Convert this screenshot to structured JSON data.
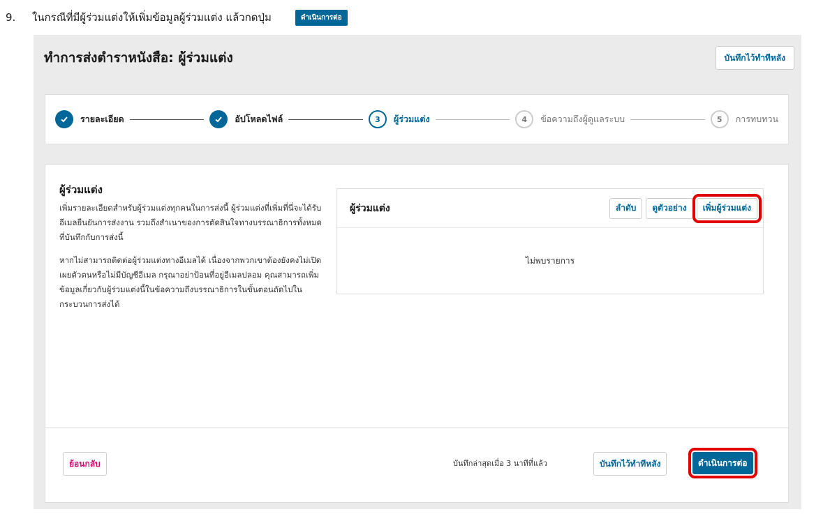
{
  "instruction": {
    "number": "9.",
    "text": "ในกรณีที่มีผู้ร่วมแต่งให้เพิ่มข้อมูลผู้ร่วมแต่ง แล้วกดปุ่ม",
    "inline_button": "ดำเนินการต่อ"
  },
  "header": {
    "title": "ทำการส่งตำราหนังสือ: ผู้ร่วมแต่ง",
    "save_later": "บันทึกไว้ทำทีหลัง"
  },
  "steps": [
    {
      "num": "",
      "label": "รายละเอียด",
      "state": "done"
    },
    {
      "num": "",
      "label": "อัปโหลดไฟล์",
      "state": "done"
    },
    {
      "num": "3",
      "label": "ผู้ร่วมแต่ง",
      "state": "current"
    },
    {
      "num": "4",
      "label": "ข้อความถึงผู้ดูแลระบบ",
      "state": "todo"
    },
    {
      "num": "5",
      "label": "การทบทวน",
      "state": "todo"
    }
  ],
  "contributors": {
    "heading": "ผู้ร่วมแต่ง",
    "desc1": "เพิ่มรายละเอียดสำหรับผู้ร่วมแต่งทุกคนในการส่งนี้ ผู้ร่วมแต่งที่เพิ่มที่นี่จะได้รับอีเมลยืนยันการส่งงาน รวมถึงสำเนาของการตัดสินใจทางบรรณาธิการทั้งหมดที่บันทึกกับการส่งนี้",
    "desc2": "หากไม่สามารถติดต่อผู้ร่วมแต่งทางอีเมลได้ เนื่องจากพวกเขาต้องยังคงไม่เปิดเผยตัวตนหรือไม่มีบัญชีอีเมล กรุณาอย่าป้อนที่อยู่อีเมลปลอม คุณสามารถเพิ่มข้อมูลเกี่ยวกับผู้ร่วมแต่งนี้ในข้อความถึงบรรณาธิการในขั้นตอนถัดไปในกระบวนการส่งได้",
    "list_title": "ผู้ร่วมแต่ง",
    "order_button": "ลำดับ",
    "preview_button": "ดูตัวอย่าง",
    "add_button": "เพิ่มผู้ร่วมแต่ง",
    "empty_text": "ไม่พบรายการ"
  },
  "footer": {
    "back": "ย้อนกลับ",
    "saved_text": "บันทึกล่าสุดเมื่อ 3 นาทีที่แล้ว",
    "save_later": "บันทึกไว้ทำทีหลัง",
    "continue": "ดำเนินการต่อ"
  },
  "colors": {
    "primary": "#006798",
    "highlight": "#e30000",
    "back_text": "#d00a6c"
  }
}
